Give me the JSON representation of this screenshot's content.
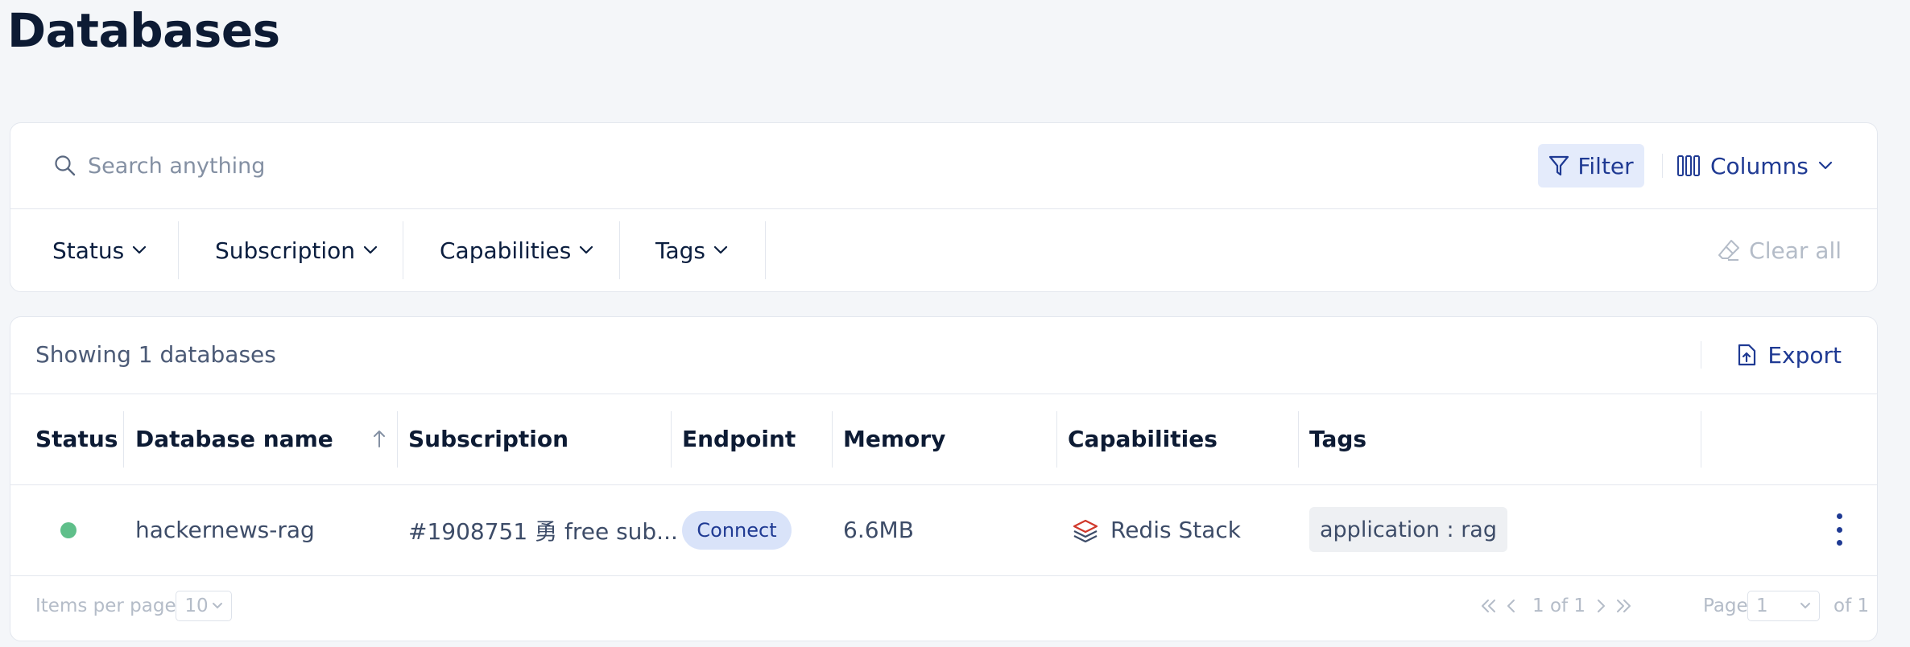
{
  "page": {
    "title": "Databases"
  },
  "search": {
    "placeholder": "Search anything"
  },
  "toolbar": {
    "filter_label": "Filter",
    "columns_label": "Columns"
  },
  "filters": {
    "facets": [
      "Status",
      "Subscription",
      "Capabilities",
      "Tags"
    ],
    "clear_all_label": "Clear all"
  },
  "table": {
    "showing_text": "Showing 1 databases",
    "export_label": "Export",
    "columns": [
      "Status",
      "Database name",
      "Subscription",
      "Endpoint",
      "Memory",
      "Capabilities",
      "Tags"
    ],
    "sorted_column": "Database name",
    "sort_direction": "ascending",
    "rows": [
      {
        "status": "active",
        "status_color": "#5fbf8a",
        "database_name": "hackernews-rag",
        "subscription": "#1908751 勇 free sub...",
        "endpoint_button": "Connect",
        "memory": "6.6MB",
        "capability_icon": "redis-stack-icon",
        "capability": "Redis Stack",
        "tag": "application : rag"
      }
    ]
  },
  "pagination": {
    "items_per_page_label": "Items per page",
    "items_per_page_value": "10",
    "page_count_text": "1 of 1",
    "page_label": "Page",
    "current_page": "1",
    "of_pages_text": "of 1"
  },
  "colors": {
    "accent": "#1f3a93",
    "filter_bg": "#e4ebfb",
    "connect_bg": "#d9e3f9",
    "status_active": "#5fbf8a",
    "redis_red": "#d0382b",
    "page_bg": "#f4f6f9"
  }
}
